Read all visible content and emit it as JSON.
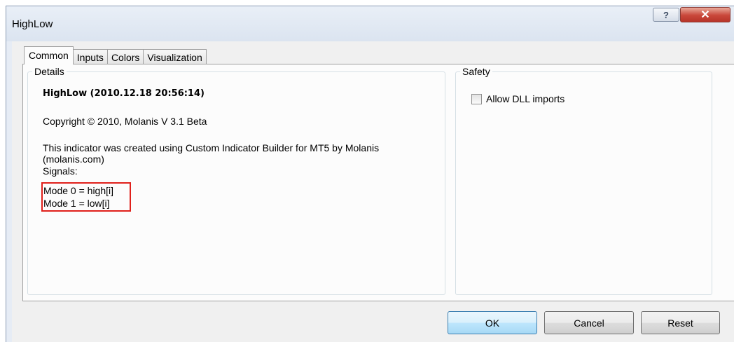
{
  "window": {
    "title": "HighLow",
    "help_glyph": "?",
    "close_glyph": "✕"
  },
  "tabs": [
    {
      "label": "Common",
      "active": true
    },
    {
      "label": "Inputs",
      "active": false
    },
    {
      "label": "Colors",
      "active": false
    },
    {
      "label": "Visualization",
      "active": false
    }
  ],
  "details": {
    "legend": "Details",
    "heading": "HighLow  (2010.12.18 20:56:14)",
    "copyright": "Copyright © 2010, Molanis V 3.1 Beta",
    "description": "This indicator was created using Custom Indicator Builder for MT5 by Molanis (molanis.com)",
    "signals_label": "Signals:",
    "signals": [
      "Mode 0 = high[i]",
      "Mode 1 = low[i]"
    ],
    "highlight_color": "#e0201b"
  },
  "safety": {
    "legend": "Safety",
    "allow_dll_label": "Allow DLL imports",
    "allow_dll_checked": false
  },
  "buttons": {
    "ok": "OK",
    "cancel": "Cancel",
    "reset": "Reset"
  }
}
